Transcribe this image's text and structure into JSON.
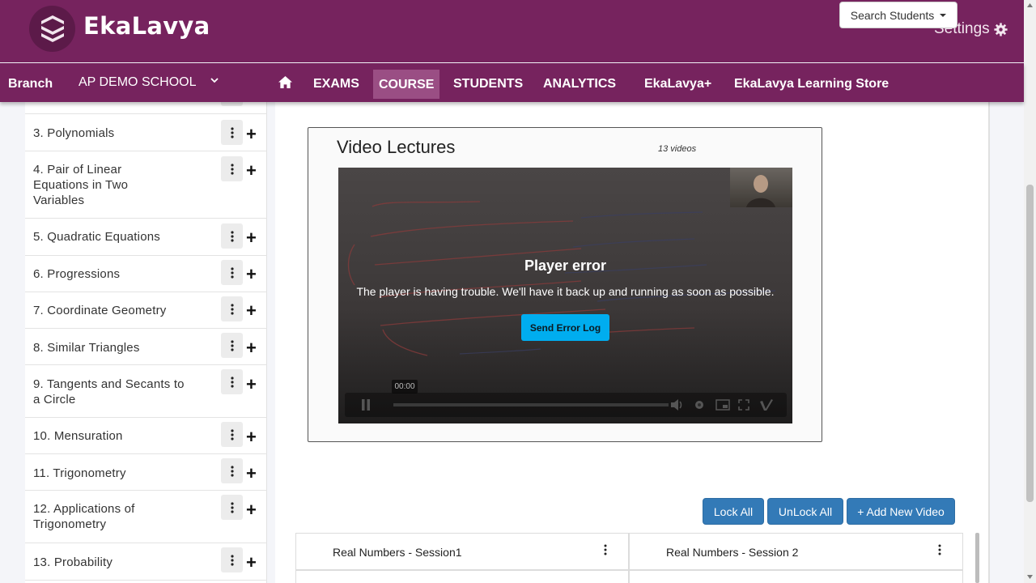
{
  "header": {
    "logo_text": "EkaLavya",
    "search_students": "Search Students",
    "settings": "Settings"
  },
  "nav": {
    "branch_label": "Branch",
    "branch_value": "AP DEMO SCHOOL",
    "items": [
      "EXAMS",
      "COURSE",
      "STUDENTS",
      "ANALYTICS",
      "EkaLavya+",
      "EkaLavya Learning Store"
    ],
    "active": "COURSE"
  },
  "sidebar": {
    "chapters": [
      "3. Polynomials",
      "4. Pair of Linear Equations in Two Variables",
      "5. Quadratic Equations",
      "6. Progressions",
      "7. Coordinate Geometry",
      "8. Similar Triangles",
      "9. Tangents and Secants to a Circle",
      "10. Mensuration",
      "11. Trigonometry",
      "12. Applications of Trigonometry",
      "13. Probability"
    ]
  },
  "video": {
    "title": "Video Lectures",
    "count": "13 videos",
    "error_title": "Player error",
    "error_message": "The player is having trouble. We'll have it back up and running as soon as possible.",
    "error_button": "Send Error Log",
    "time": "00:00"
  },
  "actions": {
    "lock_all": "Lock All",
    "unlock_all": "UnLock All",
    "add_video": "+ Add New Video"
  },
  "videos": [
    "Real Numbers - Session1",
    "Real Numbers - Session 2"
  ],
  "colors": {
    "brand": "#76235e",
    "active_nav": "#9a4e84",
    "primary_button": "#337ab7",
    "player_error_button": "#00adef"
  }
}
